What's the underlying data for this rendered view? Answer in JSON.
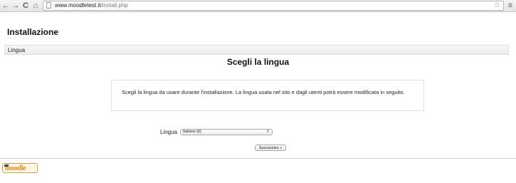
{
  "browser": {
    "back_icon": "←",
    "forward_icon": "→",
    "reload_icon": "C",
    "home_icon": "⌂",
    "url_host": "www.moodletest.it",
    "url_path": "/install.php",
    "star_icon": "☆",
    "menu_icon": "≡"
  },
  "page": {
    "heading": "Installazione",
    "breadcrumb_bar": "Lingua",
    "section_title": "Scegli la lingua",
    "info_text": "Scegli la lingua da usare durante l'installazione. La lingua usata nel sito e dagli utenti potrà essere modificata in seguito.",
    "form": {
      "language_label": "Lingua",
      "language_selected": "Italiano (it)",
      "select_arrows": "⇕",
      "next_button": "Successivo »"
    }
  },
  "footer": {
    "logo_text": "moodle"
  }
}
